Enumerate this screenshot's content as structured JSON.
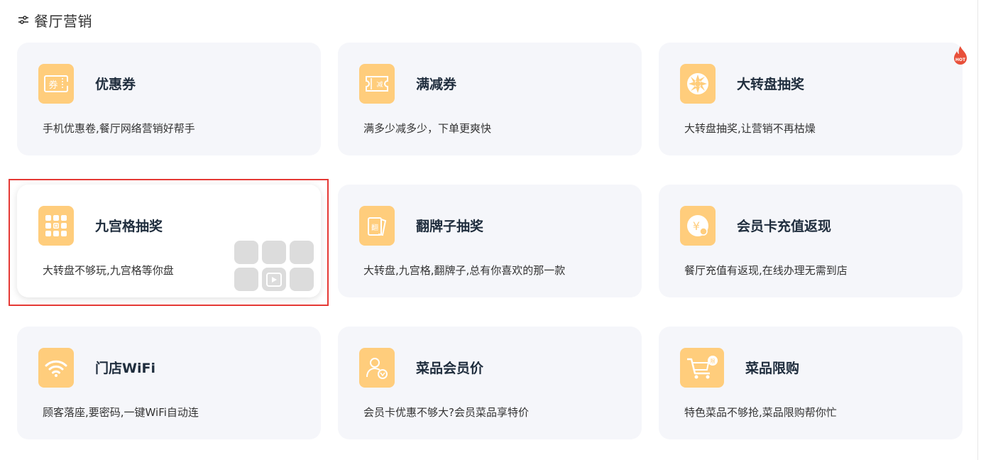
{
  "section": {
    "title": "餐厅营销",
    "icon": "filter-sliders-icon"
  },
  "colors": {
    "icon_bg": "#ffcd7c",
    "card_bg": "#f5f6fa",
    "hot_red": "#e8503a",
    "selection_border": "#e53935"
  },
  "cards": [
    {
      "title": "优惠券",
      "desc": "手机优惠卷,餐厅网络营销好帮手",
      "icon": "coupon-icon"
    },
    {
      "title": "满减券",
      "desc": "满多少减多少，下单更爽快",
      "icon": "discount-ticket-icon"
    },
    {
      "title": "大转盘抽奖",
      "desc": "大转盘抽奖,让营销不再枯燥",
      "icon": "prize-wheel-icon",
      "badge": "HOT"
    },
    {
      "title": "九宫格抽奖",
      "desc": "大转盘不够玩,九宫格等你盘",
      "icon": "nine-grid-icon"
    },
    {
      "title": "翻牌子抽奖",
      "desc": "大转盘,九宫格,翻牌子,总有你喜欢的那一款",
      "icon": "flip-card-icon"
    },
    {
      "title": "会员卡充值返现",
      "desc": "餐厅充值有返现,在线办理无需到店",
      "icon": "member-card-icon"
    },
    {
      "title": "门店WiFi",
      "desc": "顾客落座,要密码,一键WiFi自动连",
      "icon": "wifi-icon"
    },
    {
      "title": "菜品会员价",
      "desc": "会员卡优惠不够大?会员菜品享特价",
      "icon": "member-price-icon"
    },
    {
      "title": "菜品限购",
      "desc": "特色菜品不够抢,菜品限购帮你忙",
      "icon": "shopping-cart-icon"
    }
  ]
}
